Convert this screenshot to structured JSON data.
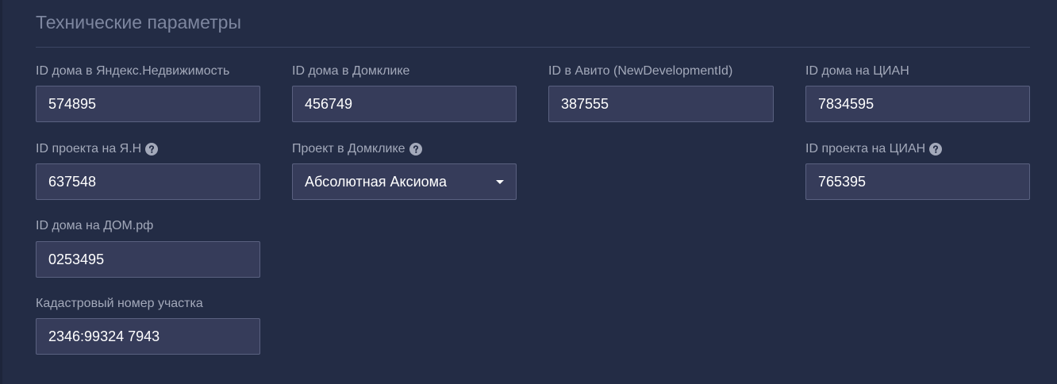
{
  "section": {
    "title": "Технические параметры"
  },
  "fields": {
    "yandex_house_id": {
      "label": "ID дома в Яндекс.Недвижимость",
      "value": "574895"
    },
    "domclick_house_id": {
      "label": "ID дома в Домклике",
      "value": "456749"
    },
    "avito_id": {
      "label": "ID в Авито (NewDevelopmentId)",
      "value": "387555"
    },
    "cian_house_id": {
      "label": "ID дома на ЦИАН",
      "value": "7834595"
    },
    "yandex_project_id": {
      "label": "ID проекта на Я.Н",
      "value": "637548",
      "help_icon": "question-circle-icon"
    },
    "domclick_project": {
      "label": "Проект в Домклике",
      "selected": "Абсолютная Аксиома",
      "help_icon": "question-circle-icon"
    },
    "cian_project_id": {
      "label": "ID проекта на ЦИАН",
      "value": "765395",
      "help_icon": "question-circle-icon"
    },
    "domrf_house_id": {
      "label": "ID дома на ДОМ.рф",
      "value": "0253495"
    },
    "cadastral_number": {
      "label": "Кадастровый номер участка",
      "value": "2346:99324 7943"
    }
  },
  "colors": {
    "background": "#232c45",
    "input_background": "#363c5a",
    "input_border": "#5a6180",
    "label": "#a3a9ba",
    "title": "#7d869f"
  }
}
